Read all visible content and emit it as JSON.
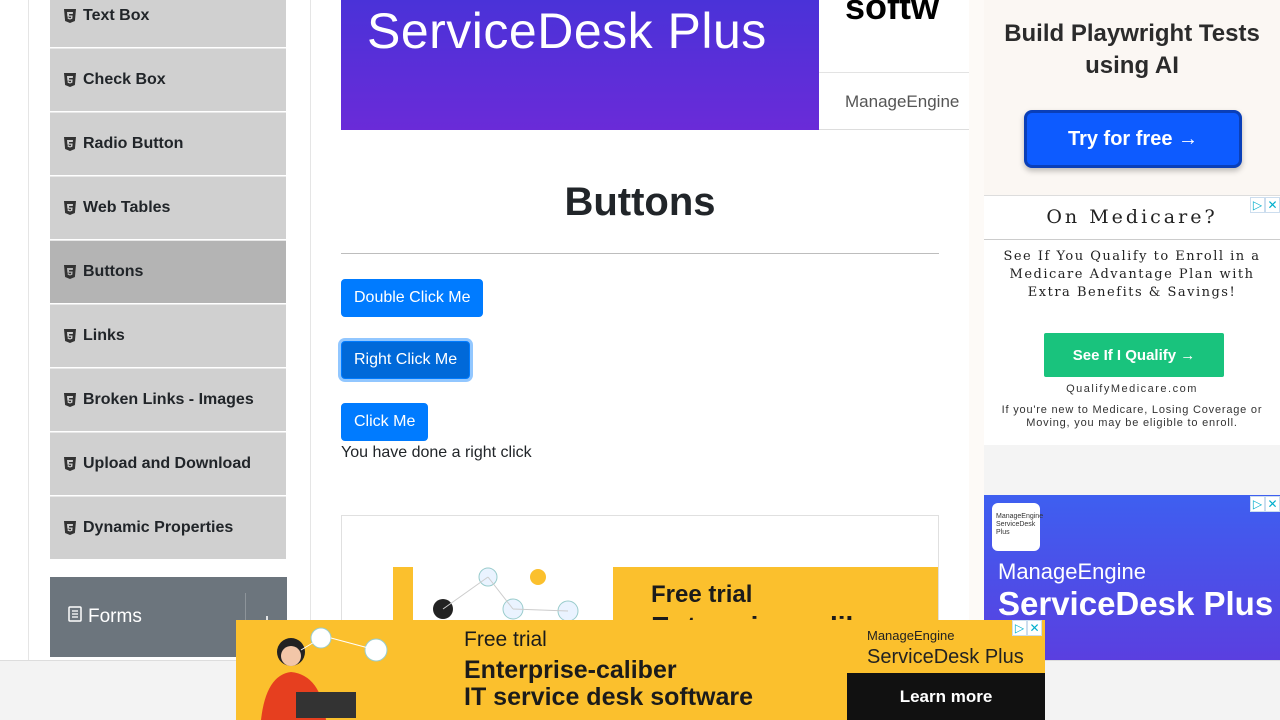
{
  "sidebar": {
    "items": [
      {
        "label": "Text Box",
        "icon": "html5-icon"
      },
      {
        "label": "Check Box",
        "icon": "html5-icon"
      },
      {
        "label": "Radio Button",
        "icon": "html5-icon"
      },
      {
        "label": "Web Tables",
        "icon": "html5-icon"
      },
      {
        "label": "Buttons",
        "icon": "html5-icon",
        "active": true
      },
      {
        "label": "Links",
        "icon": "html5-icon"
      },
      {
        "label": "Broken Links - Images",
        "icon": "html5-icon"
      },
      {
        "label": "Upload and Download",
        "icon": "html5-icon"
      },
      {
        "label": "Dynamic Properties",
        "icon": "html5-icon"
      }
    ],
    "group": {
      "label": "Forms",
      "icon": "list-icon"
    }
  },
  "top_banner": {
    "left_text": "ServiceDesk Plus",
    "right_headline": "softw",
    "right_brand": "ManageEngine"
  },
  "main": {
    "title": "Buttons",
    "buttons": {
      "double_click": "Double Click Me",
      "right_click": "Right Click Me",
      "click": "Click Me"
    },
    "message": "You have done a right click",
    "inline_ad": {
      "line1": "Free trial",
      "line2": "Enterprise-calibe"
    }
  },
  "right_ads": {
    "ad1": {
      "headline": "Build Playwright Tests using AI",
      "cta": "Try for free →"
    },
    "ad2": {
      "headline": "On Medicare?",
      "body": "See If You Qualify to Enroll in a Medicare Advantage Plan with Extra Benefits & Savings!",
      "cta": "See If I Qualify →",
      "url": "QualifyMedicare.com",
      "fine": "If you're new to Medicare, Losing Coverage or Moving, you may be eligible to enroll."
    },
    "ad3": {
      "logo_line1": "ManageEngine",
      "logo_line2": "ServiceDesk Plus",
      "brand": "ManageEngine",
      "product": "ServiceDesk Plus"
    }
  },
  "bottom_ad": {
    "line1": "Free trial",
    "line2": "Enterprise-caliber",
    "line3": "IT service desk software",
    "brand": "ManageEngine",
    "product": "ServiceDesk Plus",
    "cta": "Learn more"
  },
  "colors": {
    "primary": "#007bff",
    "sidebar_item": "#d0d0d0",
    "sidebar_active": "#b4b4b4",
    "group": "#6c757d",
    "ad_yellow": "#fbc02d"
  }
}
